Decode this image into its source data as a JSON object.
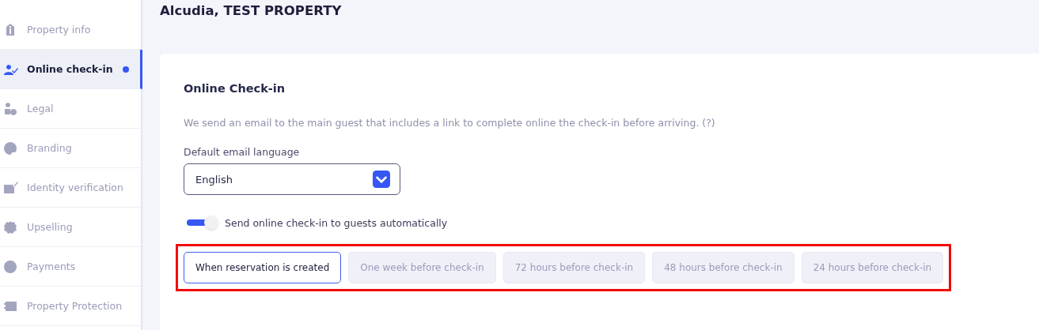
{
  "sidebar": {
    "items": [
      {
        "label": "Property info",
        "selected": false,
        "dot": false
      },
      {
        "label": "Online check-in",
        "selected": true,
        "dot": true
      },
      {
        "label": "Legal",
        "selected": false,
        "dot": false
      },
      {
        "label": "Branding",
        "selected": false,
        "dot": false
      },
      {
        "label": "Identity verification",
        "selected": false,
        "dot": false
      },
      {
        "label": "Upselling",
        "selected": false,
        "dot": false
      },
      {
        "label": "Payments",
        "selected": false,
        "dot": false
      },
      {
        "label": "Property Protection",
        "selected": false,
        "dot": false
      }
    ]
  },
  "page": {
    "title": "Alcudia, TEST PROPERTY"
  },
  "card": {
    "title": "Online Check-in",
    "description": "We send an email to the main guest that includes a link to complete online the check-in before arriving. (?)",
    "language": {
      "label": "Default email language",
      "value": "English"
    },
    "auto_send": {
      "label": "Send online check-in to guests automatically",
      "on": true
    },
    "timing": {
      "highlighted": true,
      "options": [
        {
          "label": "When reservation is created",
          "selected": true
        },
        {
          "label": "One week before check-in",
          "selected": false
        },
        {
          "label": "72 hours before check-in",
          "selected": false
        },
        {
          "label": "48 hours before check-in",
          "selected": false
        },
        {
          "label": "24 hours before check-in",
          "selected": false
        }
      ]
    }
  }
}
